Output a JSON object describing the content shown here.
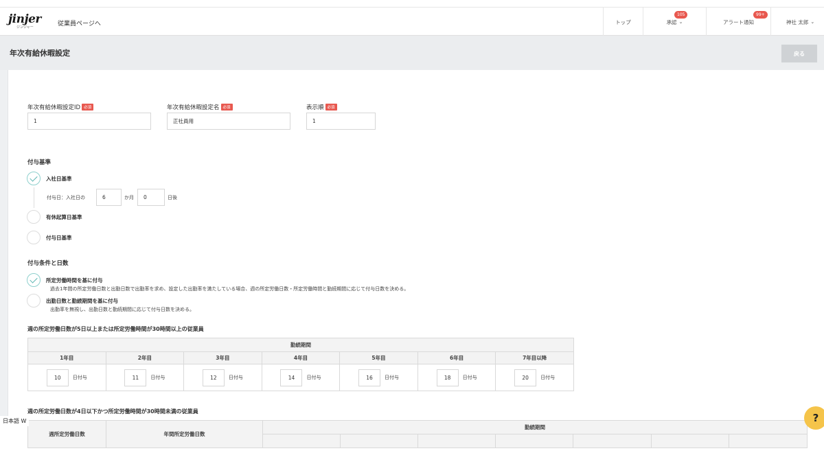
{
  "header": {
    "logo_main": "jinjer",
    "logo_sub": "ジンジャー",
    "employee_link": "従業員ページへ",
    "nav": {
      "top": "トップ",
      "approval": "承認",
      "approval_badge": "105",
      "alert": "アラート通知",
      "alert_badge": "99+",
      "user": "神社 太郎"
    }
  },
  "page": {
    "title": "年次有給休暇設定",
    "back_label": "戻る"
  },
  "form": {
    "id_label": "年次有給休暇設定ID",
    "name_label": "年次有給休暇設定名",
    "order_label": "表示順",
    "required": "必須",
    "id_value": "1",
    "name_value": "正社員用",
    "order_value": "1"
  },
  "grant_basis": {
    "title": "付与基準",
    "option1": "入社日基準",
    "grant_day_prefix": "付与日：入社日の",
    "months_value": "6",
    "months_unit": "か月",
    "days_value": "0",
    "days_unit": "日後",
    "option2": "有休起算日基準",
    "option3": "付与日基準"
  },
  "grant_conditions": {
    "title": "付与条件と日数",
    "option1": "所定労働時間を基に付与",
    "option1_desc": "過去1年間の所定労働日数と出勤日数で出勤率を求め、設定した出勤率を満たしている場合、週の所定労働日数・所定労働時間と勤続期間に応じて付与日数を決める。",
    "option2": "出勤日数と勤続期間を基に付与",
    "option2_desc": "出勤率を無視し、出勤日数と勤続期間に応じて付与日数を決める。"
  },
  "table1": {
    "title": "週の所定労働日数が5日以上または所定労働時間が30時間以上の従業員",
    "group_header": "勤続期間",
    "unit": "日付与",
    "columns": [
      {
        "header": "1年目",
        "value": "10"
      },
      {
        "header": "2年目",
        "value": "11"
      },
      {
        "header": "3年目",
        "value": "12"
      },
      {
        "header": "4年目",
        "value": "14"
      },
      {
        "header": "5年目",
        "value": "16"
      },
      {
        "header": "6年目",
        "value": "18"
      },
      {
        "header": "7年目以降",
        "value": "20"
      }
    ]
  },
  "table2": {
    "title": "週の所定労働日数が4日以下かつ所定労働時間が30時間未満の従業員",
    "col1": "週所定労働日数",
    "col2": "年間所定労働日数",
    "group_header": "勤続期間"
  },
  "misc": {
    "ime": "日本語 W",
    "help": "?"
  }
}
